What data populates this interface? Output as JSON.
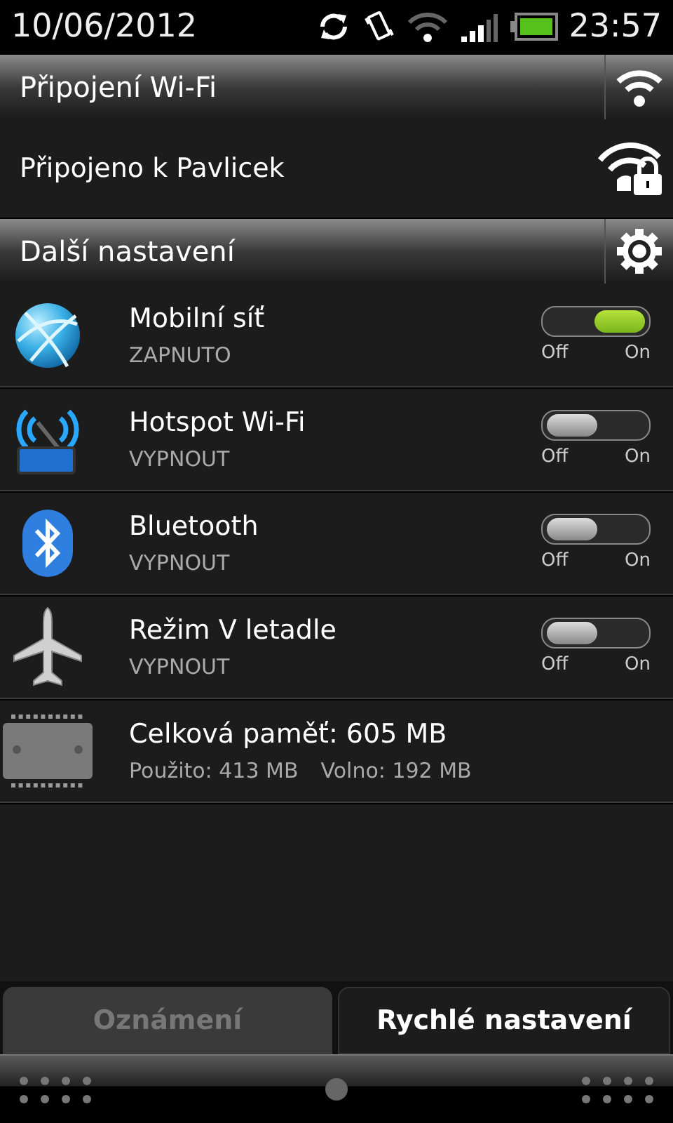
{
  "status_bar": {
    "date": "10/06/2012",
    "time": "23:57"
  },
  "wifi_header": {
    "title": "Připojení Wi-Fi"
  },
  "wifi_connection": {
    "label": "Připojeno k Pavlicek"
  },
  "settings_header": {
    "title": "Další nastavení"
  },
  "settings": [
    {
      "kind": "toggle",
      "title": "Mobilní síť",
      "status": "ZAPNUTO",
      "on": true,
      "off_label": "Off",
      "on_label": "On"
    },
    {
      "kind": "toggle",
      "title": "Hotspot Wi-Fi",
      "status": "VYPNOUT",
      "on": false,
      "off_label": "Off",
      "on_label": "On"
    },
    {
      "kind": "toggle",
      "title": "Bluetooth",
      "status": "VYPNOUT",
      "on": false,
      "off_label": "Off",
      "on_label": "On"
    },
    {
      "kind": "toggle",
      "title": "Režim V letadle",
      "status": "VYPNOUT",
      "on": false,
      "off_label": "Off",
      "on_label": "On"
    },
    {
      "kind": "memory",
      "title": "Celková paměť: 605 MB",
      "used": "Použito: 413 MB",
      "free": "Volno: 192 MB"
    }
  ],
  "tabs": [
    {
      "label": "Oznámení",
      "selected": false
    },
    {
      "label": "Rychlé nastavení",
      "selected": true
    }
  ]
}
